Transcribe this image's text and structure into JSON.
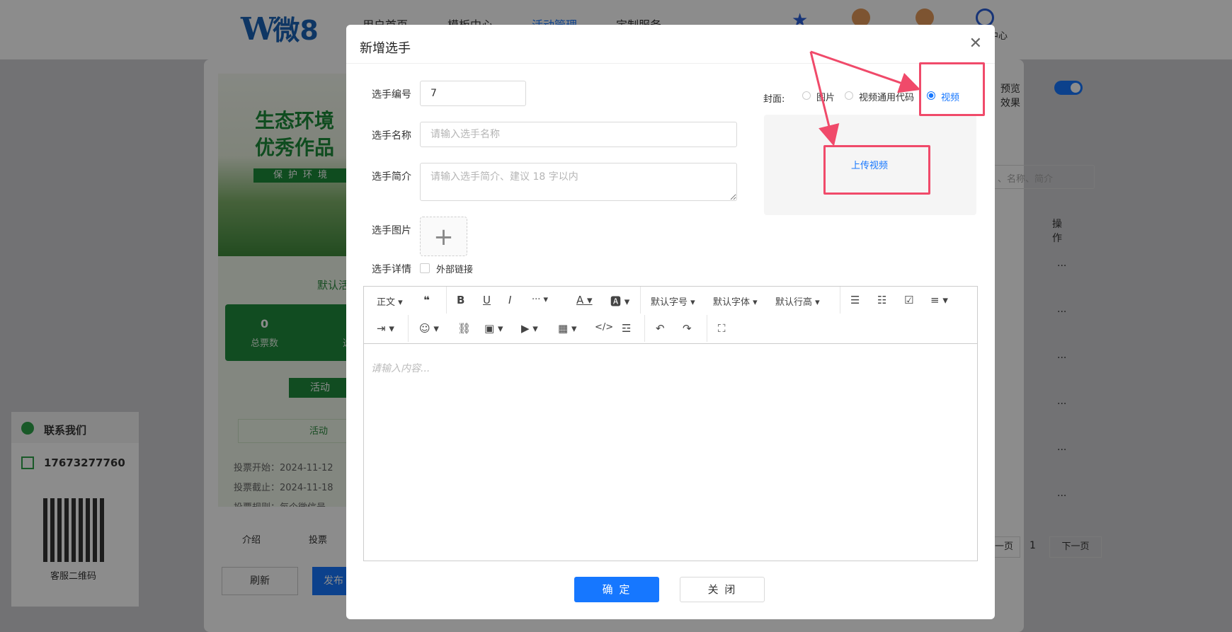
{
  "background": {
    "logo_text": "微8",
    "nav": [
      "用户首页",
      "模板中心",
      "活动管理",
      "定制服务"
    ],
    "user_center": "中心",
    "poster_title_1": "生态环境",
    "poster_title_2": "优秀作品",
    "poster_tagline": "保护环境",
    "default_text": "默认活",
    "votes_count": "0",
    "votes_label": "总票数",
    "select_label": "选",
    "activity_tag": "活动",
    "activity_sub": "活动",
    "vote_start": "投票开始：2024-11-12",
    "vote_end": "投票截止：2024-11-18",
    "vote_rule": "投票规则：每个微信号",
    "tab_intro": "介绍",
    "tab_vote": "投票",
    "refresh_button": "刷新",
    "publish_button": "发布",
    "preview_label": "预览效果",
    "search_placeholder": "、名称、简介",
    "col_action": "操作",
    "row_menu": "···",
    "prev_page": "一页",
    "page_number": "1",
    "next_page": "下一页",
    "contact_title": "联系我们",
    "phone": "17673277760",
    "qr_label": "客服二维码"
  },
  "dialog": {
    "title": "新增选手",
    "number_label": "选手编号",
    "number_value": "7",
    "name_label": "选手名称",
    "name_placeholder": "请输入选手名称",
    "intro_label": "选手简介",
    "intro_placeholder": "请输入选手简介、建议 18 字以内",
    "image_label": "选手图片",
    "detail_label": "选手详情",
    "external_link_label": "外部链接",
    "cover_label": "封面:",
    "cover_options": [
      "图片",
      "视频通用代码",
      "视频"
    ],
    "cover_selected": "视频",
    "upload_video_label": "上传视频",
    "toolbar": {
      "paragraph": "正文",
      "more": "···",
      "font_size": "默认字号",
      "font_family": "默认字体",
      "line_height": "默认行高"
    },
    "editor_placeholder": "请输入内容...",
    "confirm_button": "确 定",
    "close_button": "关 闭"
  },
  "colors": {
    "accent": "#1677ff",
    "highlight": "#f04a6a",
    "brand_green": "#1c8a3a"
  }
}
